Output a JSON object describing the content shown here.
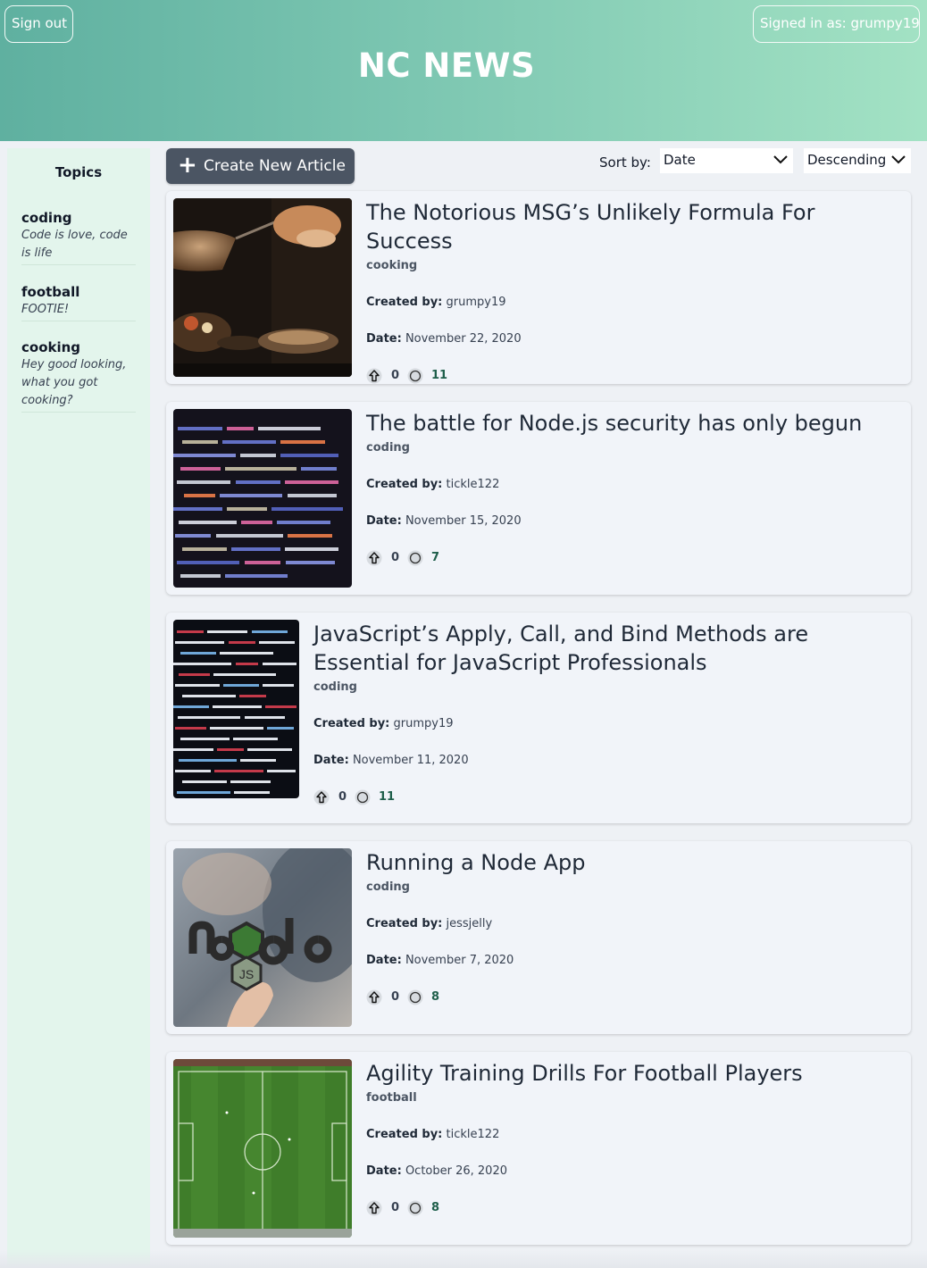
{
  "header": {
    "sign_out": "Sign out",
    "signed_in": "Signed in as: grumpy19",
    "title": "NC NEWS"
  },
  "sidebar": {
    "title": "Topics",
    "topics": [
      {
        "name": "coding",
        "description": "Code is love, code is life"
      },
      {
        "name": "football",
        "description": "FOOTIE!"
      },
      {
        "name": "cooking",
        "description": "Hey good looking, what you got cooking?"
      }
    ]
  },
  "toolbar": {
    "create_label": "Create New Article",
    "sort_label": "Sort by:",
    "sort_value": "Date",
    "order_value": "Descending"
  },
  "labels": {
    "created_by": "Created by:",
    "date": "Date:"
  },
  "articles": [
    {
      "title": "The Notorious MSG’s Unlikely Formula For Success",
      "topic": "cooking",
      "author": "grumpy19",
      "date": "November 22, 2020",
      "votes": "0",
      "comments": "11",
      "image": "cooking-photo"
    },
    {
      "title": "The battle for Node.js security has only begun",
      "topic": "coding",
      "author": "tickle122",
      "date": "November 15, 2020",
      "votes": "0",
      "comments": "7",
      "image": "code-screen-photo"
    },
    {
      "title": "JavaScript’s Apply, Call, and Bind Methods are Essential for JavaScript Professionals",
      "topic": "coding",
      "author": "grumpy19",
      "date": "November 11, 2020",
      "votes": "0",
      "comments": "11",
      "image": "code-matrix-photo"
    },
    {
      "title": "Running a Node App",
      "topic": "coding",
      "author": "jessjelly",
      "date": "November 7, 2020",
      "votes": "0",
      "comments": "8",
      "image": "nodejs-sticker-photo"
    },
    {
      "title": "Agility Training Drills For Football Players",
      "topic": "football",
      "author": "tickle122",
      "date": "October 26, 2020",
      "votes": "0",
      "comments": "8",
      "image": "football-pitch-photo"
    }
  ]
}
